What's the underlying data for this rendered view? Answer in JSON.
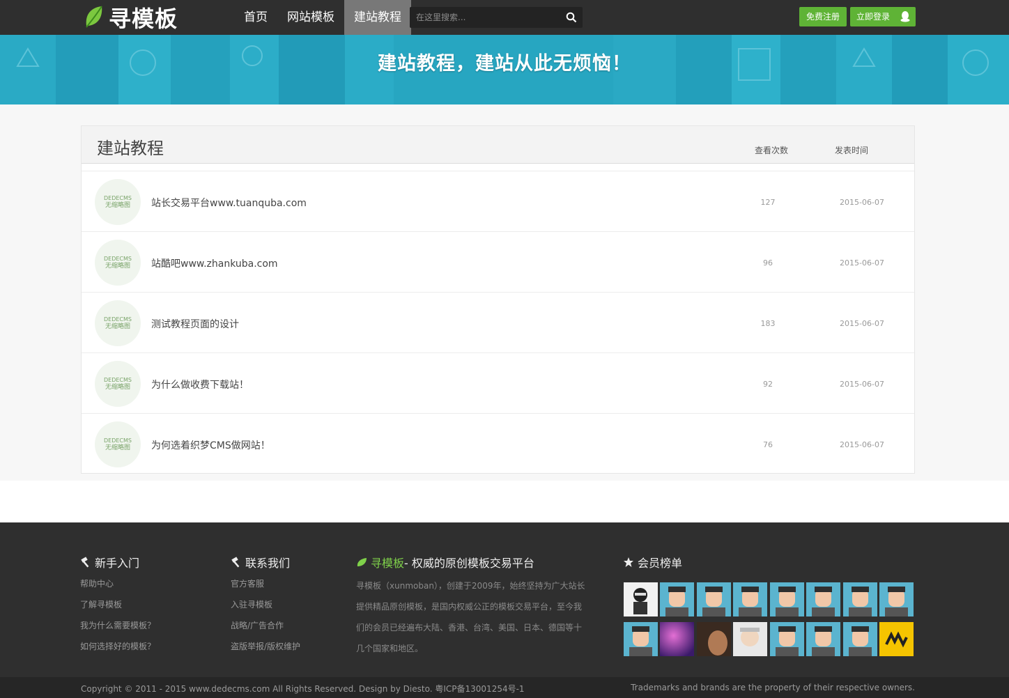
{
  "header": {
    "logo_text": "寻模板",
    "nav": [
      "首页",
      "网站模板",
      "建站教程"
    ],
    "active_nav": 2,
    "search_placeholder": "在这里搜索...",
    "register_label": "免费注册",
    "login_label": "立即登录"
  },
  "banner": {
    "slogan": "建站教程，建站从此无烦恼！"
  },
  "list": {
    "title": "建站教程",
    "col_views": "查看次数",
    "col_date": "发表时间",
    "thumb_line1": "DEDECMS",
    "thumb_line2": "无缩略图",
    "items": [
      {
        "title": "站长交易平台www.tuanquba.com",
        "views": "127",
        "date": "2015-06-07"
      },
      {
        "title": "站酷吧www.zhankuba.com",
        "views": "96",
        "date": "2015-06-07"
      },
      {
        "title": "测试教程页面的设计",
        "views": "183",
        "date": "2015-06-07"
      },
      {
        "title": "为什么做收费下载站！",
        "views": "92",
        "date": "2015-06-07"
      },
      {
        "title": "为何选着织梦CMS做网站！",
        "views": "76",
        "date": "2015-06-07"
      }
    ]
  },
  "footer": {
    "newbie": {
      "title": "新手入门",
      "links": [
        "帮助中心",
        "了解寻模板",
        "我为什么需要模板？",
        "如何选择好的模板？"
      ]
    },
    "contact": {
      "title": "联系我们",
      "links": [
        "官方客服",
        "入驻寻模板",
        "战略/广告合作",
        "盗版举报/版权维护"
      ]
    },
    "about": {
      "brand": "寻模板",
      "title_rest": " - 权威的原创模板交易平台",
      "text": "寻模板（xunmoban），创建于2009年，始终坚持为广大站长提供精品原创模板，是国内权威公正的模板交易平台，至今我们的会员已经遍布大陆、香港、台湾、美国、日本、德国等十几个国家和地区。"
    },
    "members": {
      "title": "会员榜单"
    },
    "copyright": "Copyright © 2011 - 2015 www.dedecms.com All Rights Reserved. Design by Diesto. 粤ICP备13001254号-1",
    "trademark": "Trademarks and brands are the property of their respective owners."
  },
  "colors": {
    "accent_green": "#5fb336",
    "banner_blue": "#27a6c1",
    "dark": "#2f2f2f"
  },
  "icons": [
    "leaf-logo-icon",
    "search-icon",
    "qq-penguin-icon",
    "hammer-icon",
    "star-icon"
  ]
}
